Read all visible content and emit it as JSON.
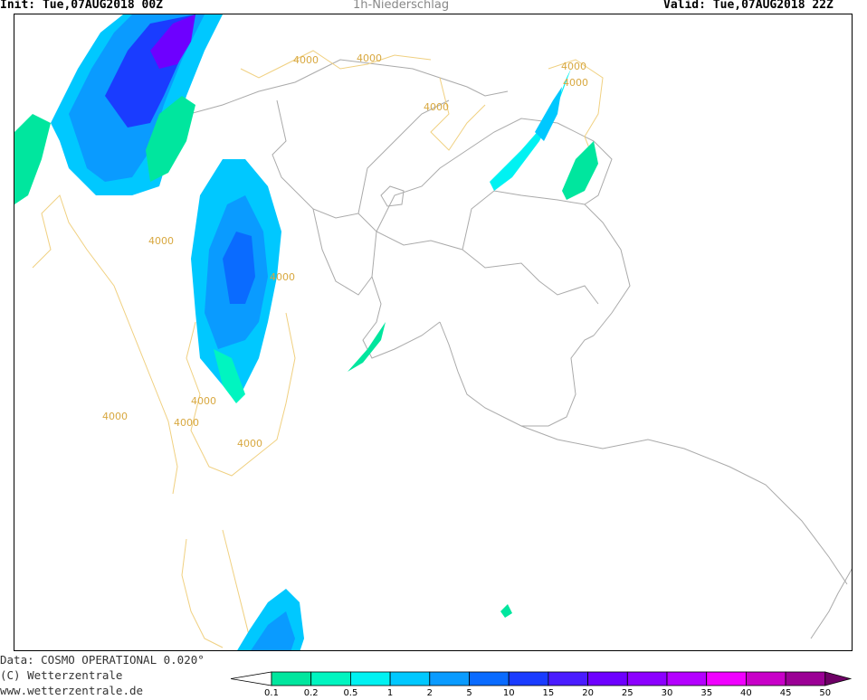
{
  "header": {
    "init": "Init: Tue,07AUG2018 00Z",
    "title": "1h-Niederschlag",
    "valid": "Valid: Tue,07AUG2018 22Z"
  },
  "footer": {
    "data_source": "Data: COSMO OPERATIONAL 0.020°",
    "copyright": "(C) Wetterzentrale",
    "website": "www.wetterzentrale.de"
  },
  "map_labels": {
    "contour": "4000"
  },
  "legend": {
    "values": [
      "0.1",
      "0.2",
      "0.5",
      "1",
      "2",
      "5",
      "10",
      "15",
      "20",
      "25",
      "30",
      "35",
      "40",
      "45",
      "50"
    ],
    "colors": [
      "#ffffff",
      "#00e69e",
      "#00f5c0",
      "#00f2f2",
      "#00c8ff",
      "#0a9bff",
      "#0a6bff",
      "#1a3cff",
      "#4a1cff",
      "#6e00ff",
      "#8c00ff",
      "#b400ff",
      "#f000ff",
      "#c800c8",
      "#9b0095",
      "#6e0066"
    ]
  }
}
